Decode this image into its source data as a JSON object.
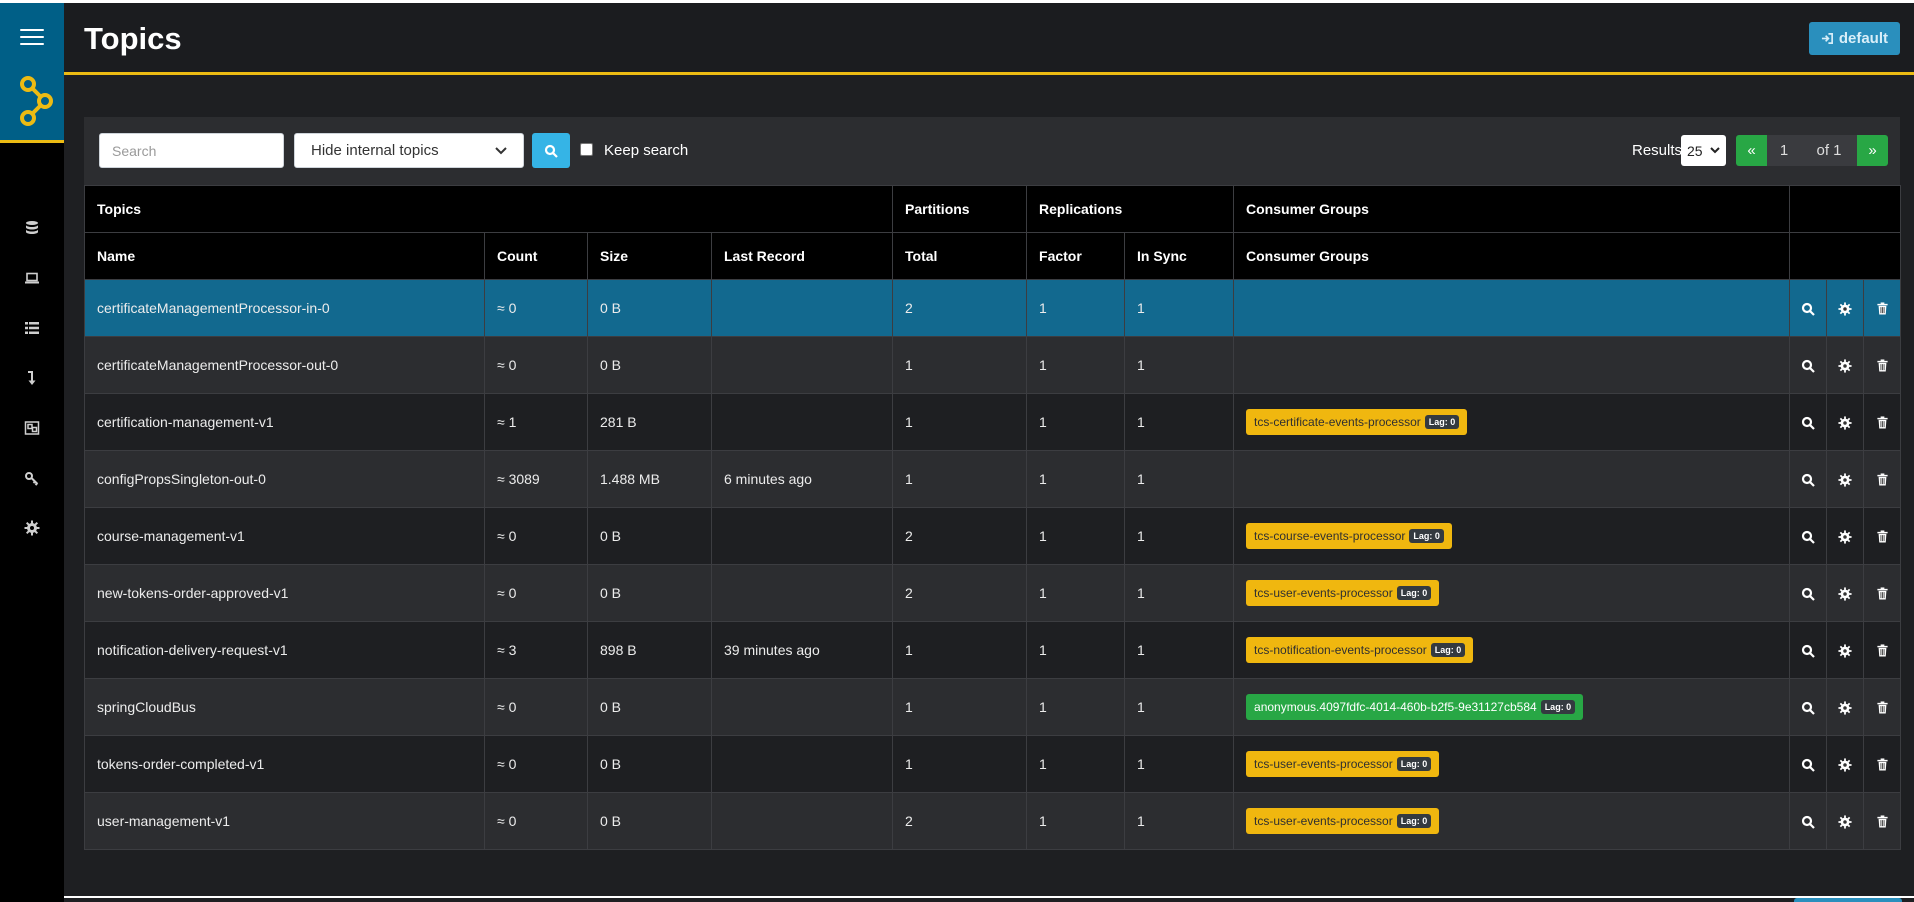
{
  "header": {
    "title": "Topics",
    "login_label": "default"
  },
  "sidebar": {
    "items": [
      {
        "icon": "database-icon"
      },
      {
        "icon": "laptop-icon"
      },
      {
        "icon": "list-icon"
      },
      {
        "icon": "level-down-icon"
      },
      {
        "icon": "object-group-icon"
      },
      {
        "icon": "key-icon"
      },
      {
        "icon": "gear-icon"
      }
    ]
  },
  "toolbar": {
    "search_placeholder": "Search",
    "filter_value": "Hide internal topics",
    "keep_search_label": "Keep search",
    "results_label": "Results",
    "results_per_page": "25",
    "pager": {
      "prev": "«",
      "current": "1",
      "of": "of 1",
      "next": "»"
    }
  },
  "table": {
    "group_headers": [
      "Topics",
      "Partitions",
      "Replications",
      "Consumer Groups"
    ],
    "columns": [
      "Name",
      "Count",
      "Size",
      "Last Record",
      "Total",
      "Factor",
      "In Sync",
      "Consumer Groups"
    ],
    "rows": [
      {
        "name": "certificateManagementProcessor-in-0",
        "count": "≈ 0",
        "size": "0 B",
        "last_record": "",
        "total": "2",
        "factor": "1",
        "in_sync": "1",
        "groups": [],
        "selected": true
      },
      {
        "name": "certificateManagementProcessor-out-0",
        "count": "≈ 0",
        "size": "0 B",
        "last_record": "",
        "total": "1",
        "factor": "1",
        "in_sync": "1",
        "groups": []
      },
      {
        "name": "certification-management-v1",
        "count": "≈ 1",
        "size": "281 B",
        "last_record": "",
        "total": "1",
        "factor": "1",
        "in_sync": "1",
        "groups": [
          {
            "name": "tcs-certificate-events-processor",
            "lag": "Lag: 0",
            "color": "#f0b70f"
          }
        ]
      },
      {
        "name": "configPropsSingleton-out-0",
        "count": "≈ 3089",
        "size": "1.488 MB",
        "last_record": "6 minutes ago",
        "total": "1",
        "factor": "1",
        "in_sync": "1",
        "groups": []
      },
      {
        "name": "course-management-v1",
        "count": "≈ 0",
        "size": "0 B",
        "last_record": "",
        "total": "2",
        "factor": "1",
        "in_sync": "1",
        "groups": [
          {
            "name": "tcs-course-events-processor",
            "lag": "Lag: 0",
            "color": "#f0b70f"
          }
        ]
      },
      {
        "name": "new-tokens-order-approved-v1",
        "count": "≈ 0",
        "size": "0 B",
        "last_record": "",
        "total": "2",
        "factor": "1",
        "in_sync": "1",
        "groups": [
          {
            "name": "tcs-user-events-processor",
            "lag": "Lag: 0",
            "color": "#f0b70f"
          }
        ]
      },
      {
        "name": "notification-delivery-request-v1",
        "count": "≈ 3",
        "size": "898 B",
        "last_record": "39 minutes ago",
        "total": "1",
        "factor": "1",
        "in_sync": "1",
        "groups": [
          {
            "name": "tcs-notification-events-processor",
            "lag": "Lag: 0",
            "color": "#f0b70f"
          }
        ]
      },
      {
        "name": "springCloudBus",
        "count": "≈ 0",
        "size": "0 B",
        "last_record": "",
        "total": "1",
        "factor": "1",
        "in_sync": "1",
        "groups": [
          {
            "name": "anonymous.4097fdfc-4014-460b-b2f5-9e31127cb584",
            "lag": "Lag: 0",
            "color": "#28a745"
          }
        ]
      },
      {
        "name": "tokens-order-completed-v1",
        "count": "≈ 0",
        "size": "0 B",
        "last_record": "",
        "total": "1",
        "factor": "1",
        "in_sync": "1",
        "groups": [
          {
            "name": "tcs-user-events-processor",
            "lag": "Lag: 0",
            "color": "#f0b70f"
          }
        ]
      },
      {
        "name": "user-management-v1",
        "count": "≈ 0",
        "size": "0 B",
        "last_record": "",
        "total": "2",
        "factor": "1",
        "in_sync": "1",
        "groups": [
          {
            "name": "tcs-user-events-processor",
            "lag": "Lag: 0",
            "color": "#f0b70f"
          }
        ]
      }
    ]
  },
  "colors": {
    "accent": "#ecbb13",
    "brand": "#005f87",
    "selected_row": "#12698f",
    "badge": "#f0b70f",
    "badge_green": "#28a745",
    "primary": "#2a8fbd"
  }
}
